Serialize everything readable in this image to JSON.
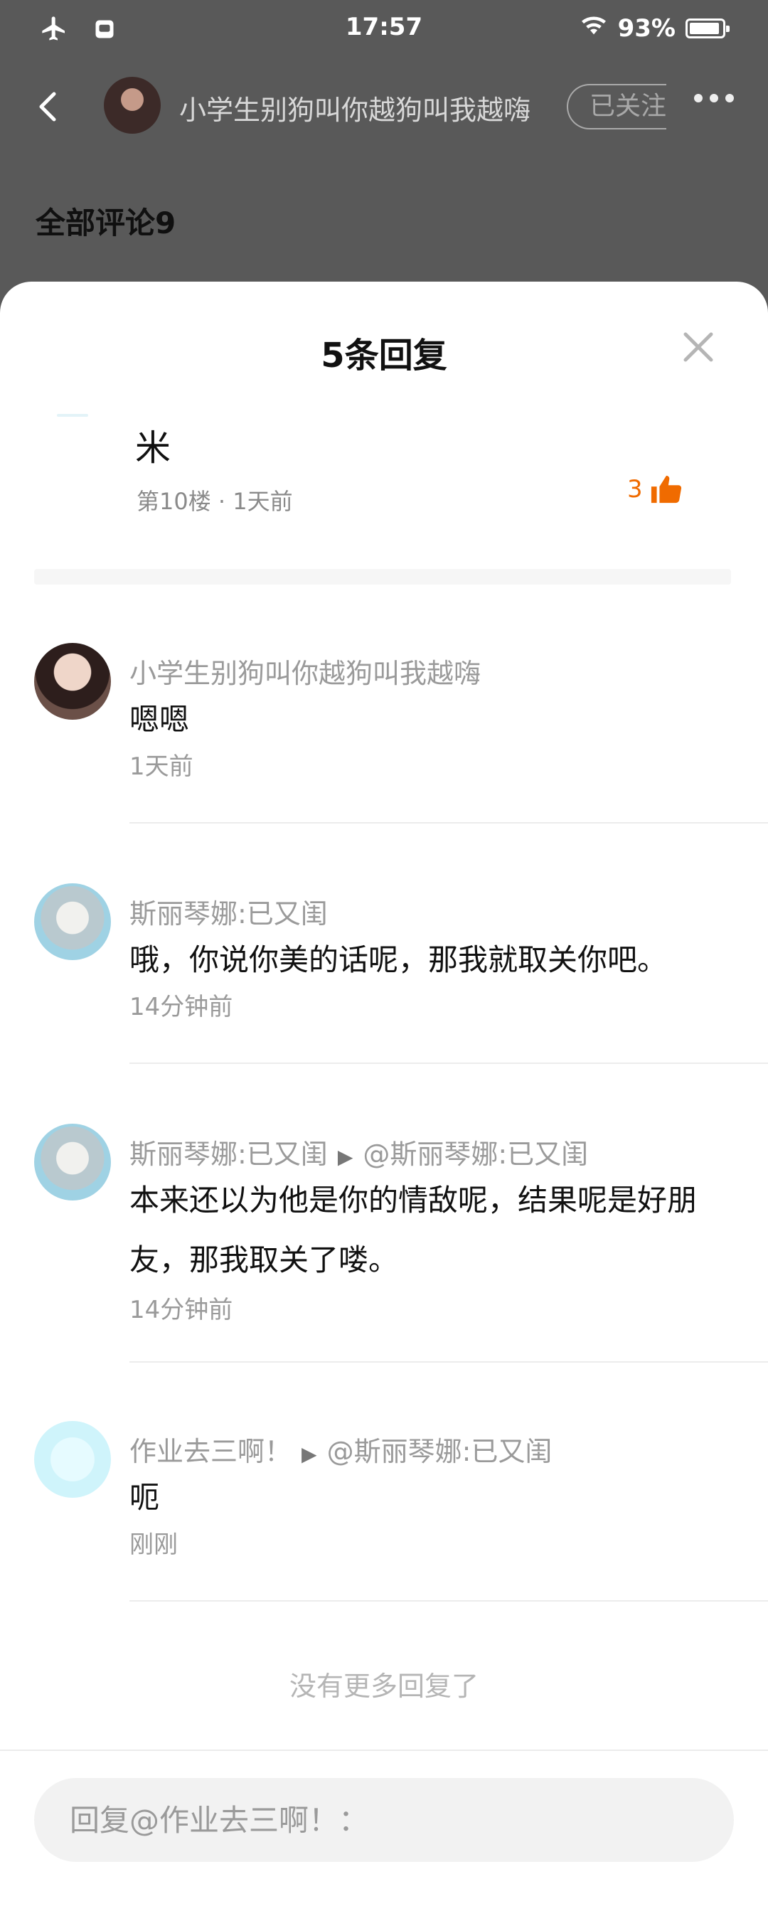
{
  "status_bar": {
    "time": "17:57",
    "battery": "93%",
    "battery_level": 0.93
  },
  "top_bar": {
    "author_name": "小学生别狗叫你越狗叫我越嗨",
    "follow_label": "已关注"
  },
  "comments_header": "全部评论9",
  "sheet": {
    "title": "5条回复",
    "parent": {
      "text": "米",
      "meta": "第10楼 · 1天前",
      "likes": "3"
    },
    "replies": [
      {
        "author": "小学生别狗叫你越狗叫我越嗨",
        "content": "嗯嗯",
        "time": "1天前"
      },
      {
        "author": "斯丽琴娜:已又闺",
        "content": "哦，你说你美的话呢，那我就取关你吧。",
        "time": "14分钟前"
      },
      {
        "author": "斯丽琴娜:已又闺",
        "reply_to": "@斯丽琴娜:已又闺",
        "content": " 本来还以为他是你的情敌呢，结果呢是好朋友，那我取关了喽。",
        "time": "14分钟前"
      },
      {
        "author": "作业去三啊！",
        "reply_to": "@斯丽琴娜:已又闺",
        "content": "呃",
        "time": "刚刚"
      }
    ],
    "no_more": "没有更多回复了",
    "input_placeholder": "回复@作业去三啊！："
  },
  "colors": {
    "accent_orange": "#f06b00",
    "overlay": "#595959"
  }
}
